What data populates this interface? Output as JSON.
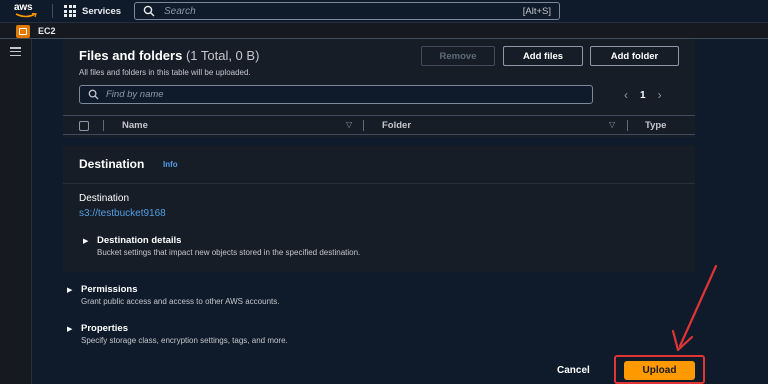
{
  "topbar": {
    "logo_text": "aws",
    "services_label": "Services",
    "search_placeholder": "Search",
    "search_shortcut": "[Alt+S]"
  },
  "subbar": {
    "service_label": "EC2"
  },
  "files": {
    "title": "Files and folders",
    "count": "(1 Total, 0 B)",
    "description": "All files and folders in this table will be uploaded.",
    "remove_label": "Remove",
    "add_files_label": "Add files",
    "add_folder_label": "Add folder",
    "find_placeholder": "Find by name",
    "page_number": "1",
    "columns": [
      "Name",
      "Folder",
      "Type"
    ]
  },
  "destination": {
    "title": "Destination",
    "info_label": "Info",
    "label": "Destination",
    "value": "s3://testbucket9168",
    "details_title": "Destination details",
    "details_desc": "Bucket settings that impact new objects stored in the specified destination."
  },
  "permissions": {
    "title": "Permissions",
    "desc": "Grant public access and access to other AWS accounts."
  },
  "properties": {
    "title": "Properties",
    "desc": "Specify storage class, encryption settings, tags, and more."
  },
  "footer": {
    "cancel_label": "Cancel",
    "upload_label": "Upload"
  },
  "colors": {
    "accent": "#ff9900",
    "link": "#539fe5",
    "highlight": "#e03535"
  }
}
